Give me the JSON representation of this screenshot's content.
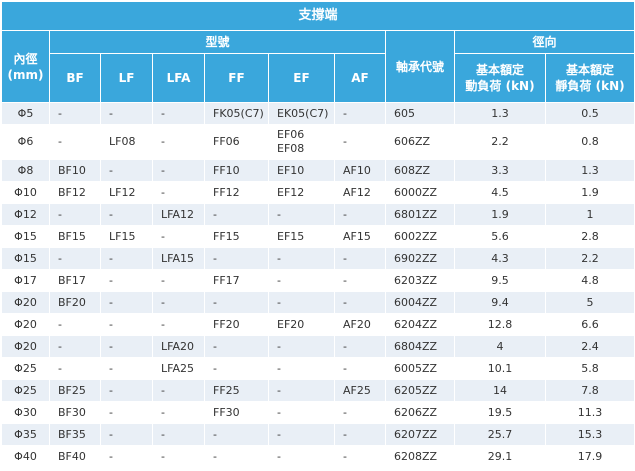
{
  "header": {
    "support_end": "支撐端",
    "inner_dia": "內徑",
    "inner_dia_unit": "(mm)",
    "model_no": "型號",
    "bearing_code": "軸承代號",
    "radial": "徑向",
    "dyn_load": [
      "基本額定",
      "動負荷 (kN)"
    ],
    "static_load": [
      "基本額定",
      "靜負荷 (kN)"
    ],
    "cols": [
      "BF",
      "LF",
      "LFA",
      "FF",
      "EF",
      "AF"
    ]
  },
  "rows": [
    {
      "d": "Φ5",
      "bf": "-",
      "lf": "-",
      "lfa": "-",
      "ff": "FK05(C7)",
      "ef": [
        "EK05(C7)"
      ],
      "af": "-",
      "code": "605",
      "dyn": "1.3",
      "stat": "0.5"
    },
    {
      "d": "Φ6",
      "bf": "-",
      "lf": "LF08",
      "lfa": "-",
      "ff": "FF06",
      "ef": [
        "EF06",
        "EF08"
      ],
      "af": "-",
      "code": "606ZZ",
      "dyn": "2.2",
      "stat": "0.8"
    },
    {
      "d": "Φ8",
      "bf": "BF10",
      "lf": "-",
      "lfa": "-",
      "ff": "FF10",
      "ef": [
        "EF10"
      ],
      "af": "AF10",
      "code": "608ZZ",
      "dyn": "3.3",
      "stat": "1.3"
    },
    {
      "d": "Φ10",
      "bf": "BF12",
      "lf": "LF12",
      "lfa": "-",
      "ff": "FF12",
      "ef": [
        "EF12"
      ],
      "af": "AF12",
      "code": "6000ZZ",
      "dyn": "4.5",
      "stat": "1.9"
    },
    {
      "d": "Φ12",
      "bf": "-",
      "lf": "-",
      "lfa": "LFA12",
      "ff": "-",
      "ef": [
        "-"
      ],
      "af": "-",
      "code": "6801ZZ",
      "dyn": "1.9",
      "stat": "1"
    },
    {
      "d": "Φ15",
      "bf": "BF15",
      "lf": "LF15",
      "lfa": "-",
      "ff": "FF15",
      "ef": [
        "EF15"
      ],
      "af": "AF15",
      "code": "6002ZZ",
      "dyn": "5.6",
      "stat": "2.8"
    },
    {
      "d": "Φ15",
      "bf": "-",
      "lf": "-",
      "lfa": "LFA15",
      "ff": "-",
      "ef": [
        "-"
      ],
      "af": "-",
      "code": "6902ZZ",
      "dyn": "4.3",
      "stat": "2.2"
    },
    {
      "d": "Φ17",
      "bf": "BF17",
      "lf": "-",
      "lfa": "-",
      "ff": "FF17",
      "ef": [
        "-"
      ],
      "af": "-",
      "code": "6203ZZ",
      "dyn": "9.5",
      "stat": "4.8"
    },
    {
      "d": "Φ20",
      "bf": "BF20",
      "lf": "-",
      "lfa": "-",
      "ff": "-",
      "ef": [
        "-"
      ],
      "af": "-",
      "code": "6004ZZ",
      "dyn": "9.4",
      "stat": "5"
    },
    {
      "d": "Φ20",
      "bf": "-",
      "lf": "-",
      "lfa": "-",
      "ff": "FF20",
      "ef": [
        "EF20"
      ],
      "af": "AF20",
      "code": "6204ZZ",
      "dyn": "12.8",
      "stat": "6.6"
    },
    {
      "d": "Φ20",
      "bf": "-",
      "lf": "-",
      "lfa": "LFA20",
      "ff": "-",
      "ef": [
        "-"
      ],
      "af": "-",
      "code": "6804ZZ",
      "dyn": "4",
      "stat": "2.4"
    },
    {
      "d": "Φ25",
      "bf": "-",
      "lf": "-",
      "lfa": "LFA25",
      "ff": "-",
      "ef": [
        "-"
      ],
      "af": "-",
      "code": "6005ZZ",
      "dyn": "10.1",
      "stat": "5.8"
    },
    {
      "d": "Φ25",
      "bf": "BF25",
      "lf": "-",
      "lfa": "-",
      "ff": "FF25",
      "ef": [
        "-"
      ],
      "af": "AF25",
      "code": "6205ZZ",
      "dyn": "14",
      "stat": "7.8"
    },
    {
      "d": "Φ30",
      "bf": "BF30",
      "lf": "-",
      "lfa": "-",
      "ff": "FF30",
      "ef": [
        "-"
      ],
      "af": "-",
      "code": "6206ZZ",
      "dyn": "19.5",
      "stat": "11.3"
    },
    {
      "d": "Φ35",
      "bf": "BF35",
      "lf": "-",
      "lfa": "-",
      "ff": "-",
      "ef": [
        "-"
      ],
      "af": "-",
      "code": "6207ZZ",
      "dyn": "25.7",
      "stat": "15.3"
    },
    {
      "d": "Φ40",
      "bf": "BF40",
      "lf": "-",
      "lfa": "-",
      "ff": "-",
      "ef": [
        "-"
      ],
      "af": "-",
      "code": "6208ZZ",
      "dyn": "29.1",
      "stat": "17.9"
    }
  ],
  "colors": {
    "header_bg": "#3aa7dc",
    "header_text": "#ffffff",
    "row_alt": "#e9eff6",
    "row_plain": "#ffffff",
    "text": "#333333"
  }
}
